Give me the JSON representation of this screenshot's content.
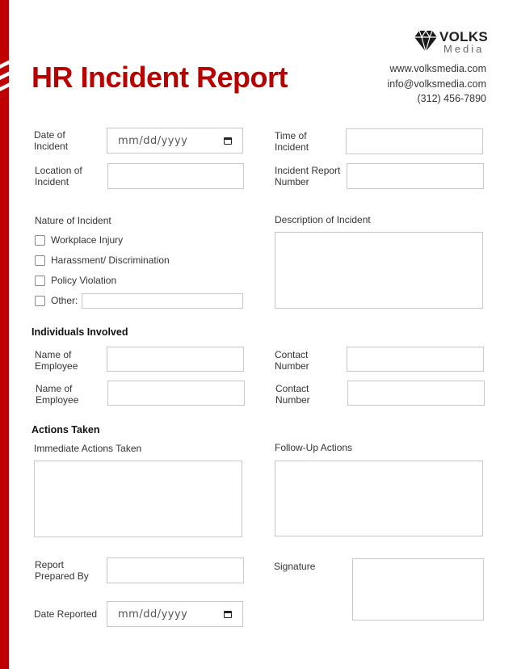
{
  "header": {
    "title": "HR Incident Report",
    "brand": {
      "name": "VOLKS",
      "subname": "Media",
      "icon": "diamond-icon"
    },
    "contact": {
      "website": "www.volksmedia.com",
      "email": "info@volksmedia.com",
      "phone": "(312) 456-7890"
    },
    "accent_color": "#c00000"
  },
  "incident": {
    "date_label": "Date of Incident",
    "date_placeholder": "mm/dd/yyyy",
    "time_label": "Time of Incident",
    "location_label": "Location of Incident",
    "report_number_label": "Incident Report Number"
  },
  "nature": {
    "label": "Nature of Incident",
    "options": [
      "Workplace Injury",
      "Harassment/ Discrimination",
      "Policy Violation",
      "Other:"
    ]
  },
  "description": {
    "label": "Description of Incident"
  },
  "individuals": {
    "heading": "Individuals Involved",
    "rows": [
      {
        "name_label": "Name of Employee",
        "contact_label": "Contact Number"
      },
      {
        "name_label": "Name of Employee",
        "contact_label": "Contact Number"
      }
    ]
  },
  "actions": {
    "heading": "Actions Taken",
    "immediate_label": "Immediate Actions Taken",
    "followup_label": "Follow-Up Actions"
  },
  "footer": {
    "prepared_by_label": "Report Prepared By",
    "signature_label": "Signature",
    "date_reported_label": "Date Reported",
    "date_placeholder": "mm/dd/yyyy"
  }
}
